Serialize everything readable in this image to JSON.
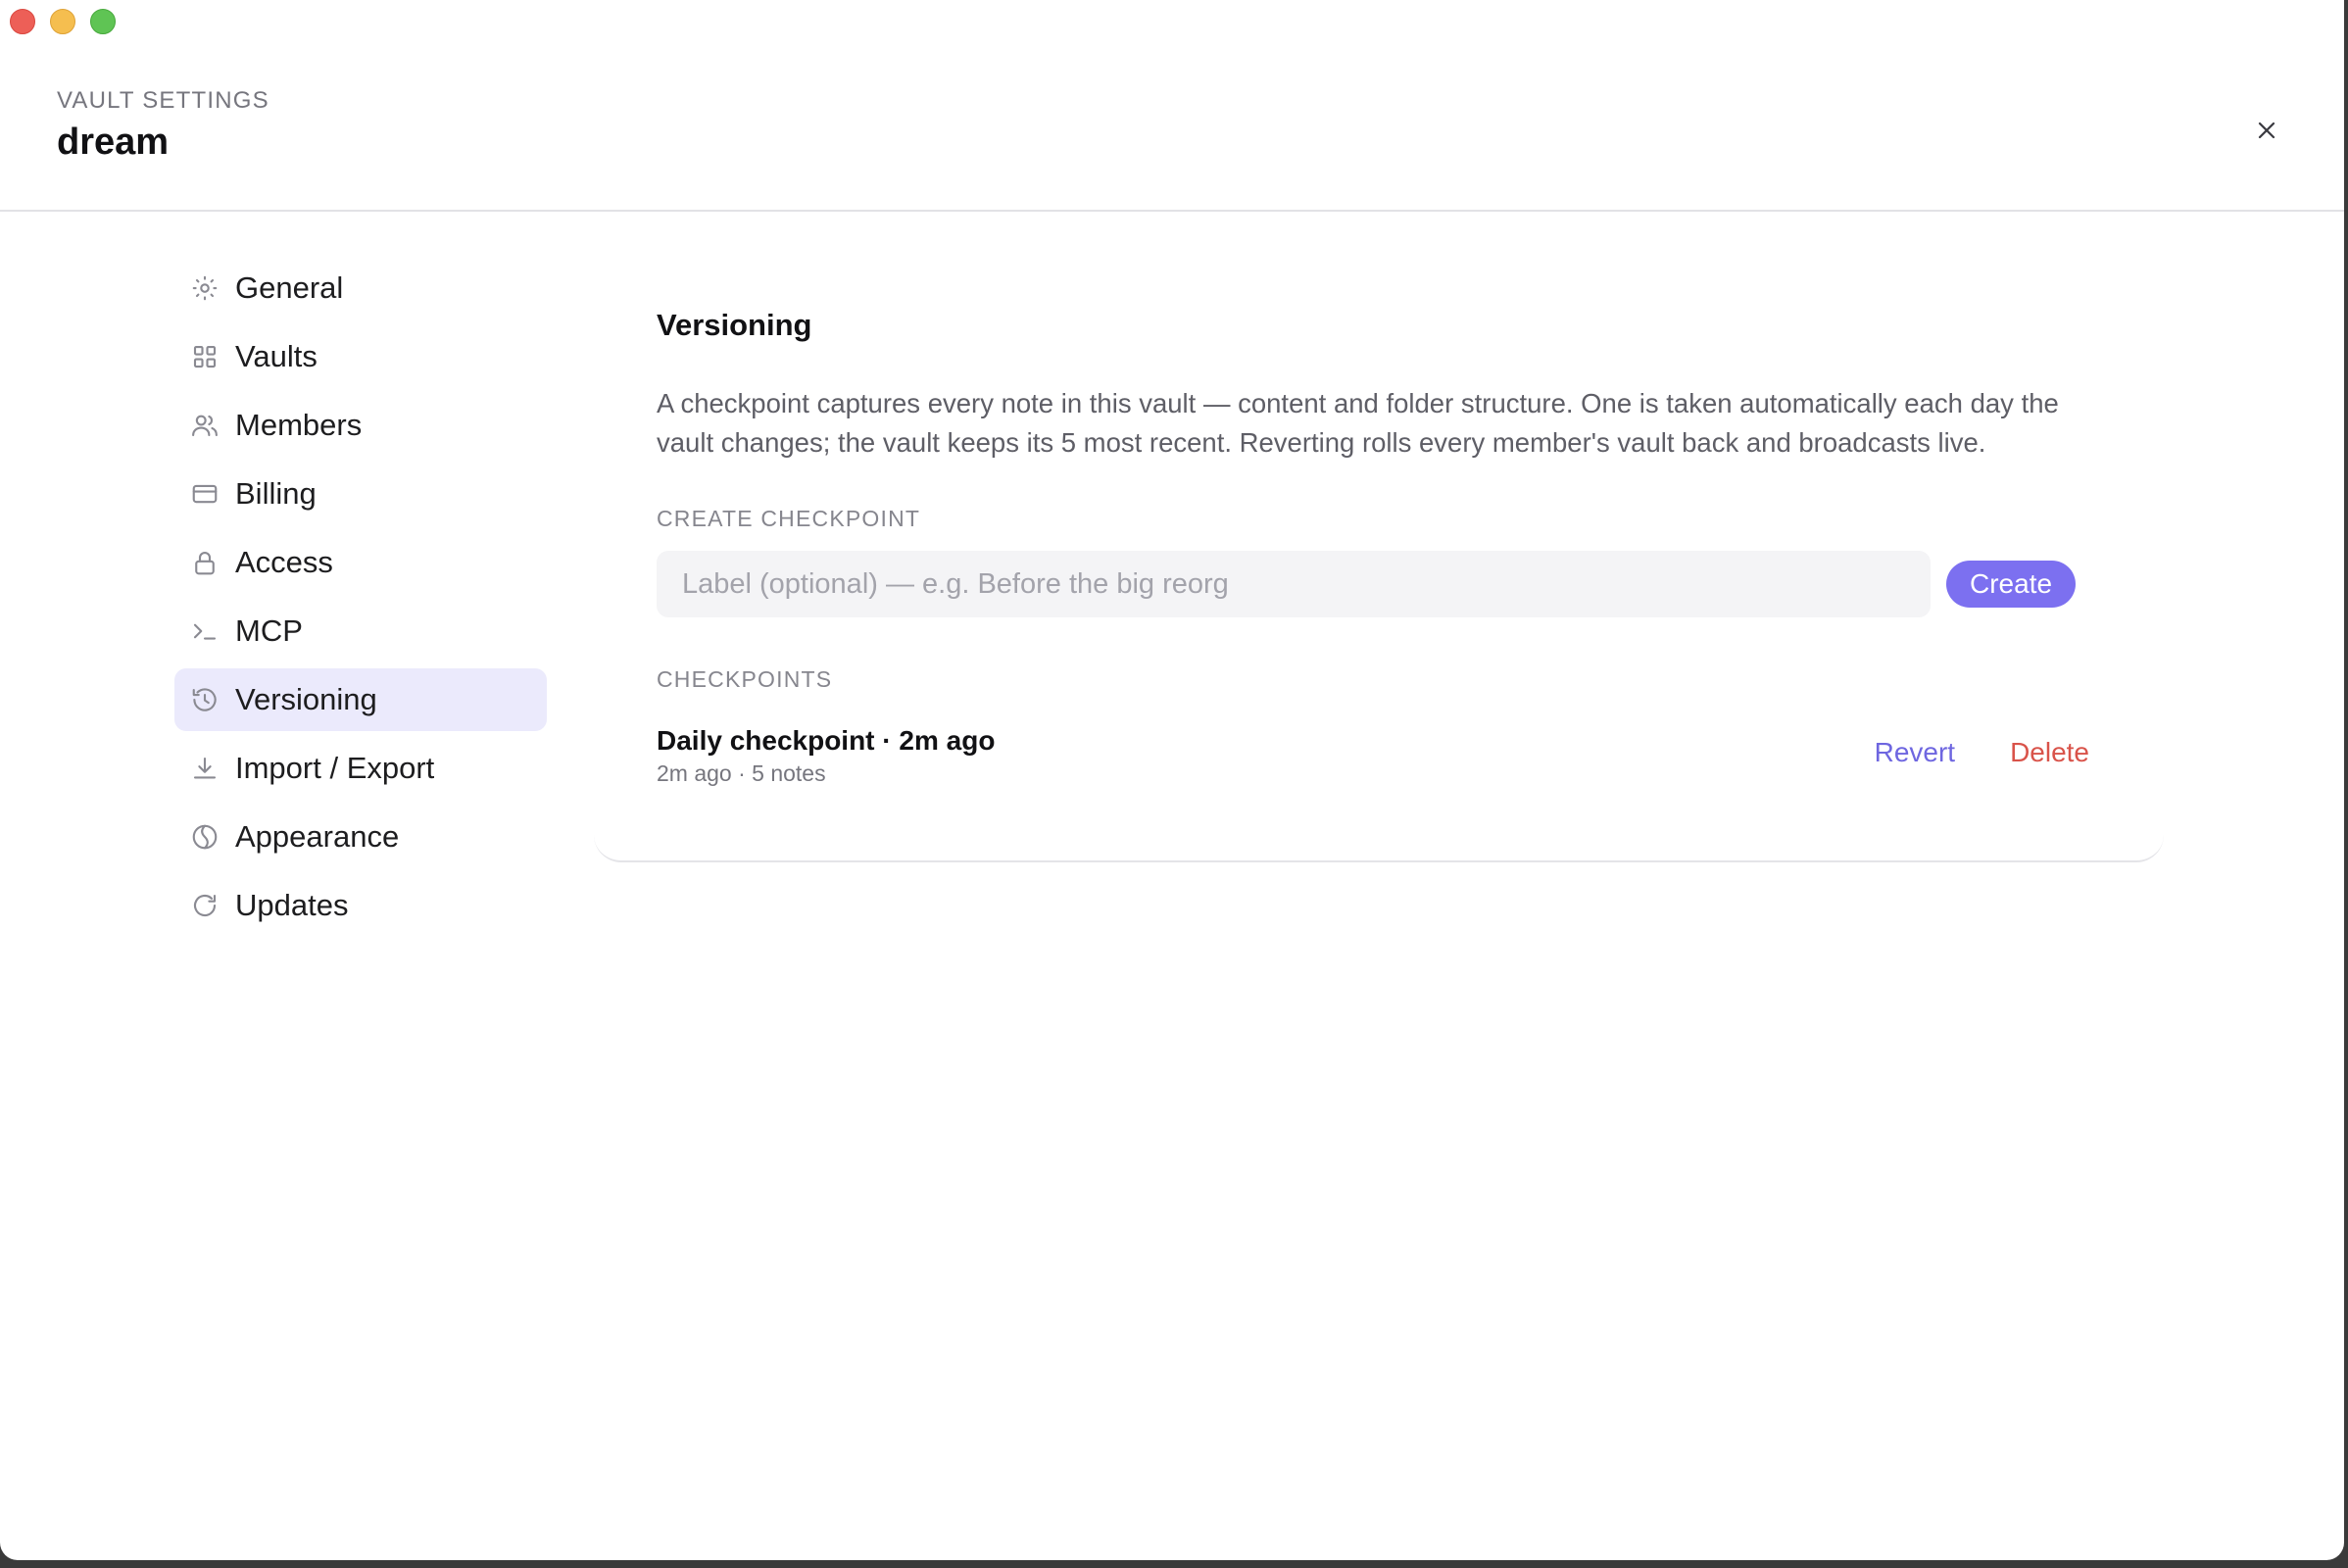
{
  "window": {
    "controls": [
      "close",
      "minimize",
      "maximize"
    ]
  },
  "header": {
    "eyebrow": "VAULT SETTINGS",
    "vault_name": "dream",
    "close_icon": "close-icon"
  },
  "sidebar": {
    "items": [
      {
        "label": "General",
        "icon": "sun-icon",
        "active": false
      },
      {
        "label": "Vaults",
        "icon": "grid-icon",
        "active": false
      },
      {
        "label": "Members",
        "icon": "users-icon",
        "active": false
      },
      {
        "label": "Billing",
        "icon": "card-icon",
        "active": false
      },
      {
        "label": "Access",
        "icon": "lock-icon",
        "active": false
      },
      {
        "label": "MCP",
        "icon": "terminal-icon",
        "active": false
      },
      {
        "label": "Versioning",
        "icon": "history-icon",
        "active": true
      },
      {
        "label": "Import / Export",
        "icon": "download-icon",
        "active": false
      },
      {
        "label": "Appearance",
        "icon": "appearance-icon",
        "active": false
      },
      {
        "label": "Updates",
        "icon": "refresh-icon",
        "active": false
      }
    ]
  },
  "main": {
    "title": "Versioning",
    "description": "A checkpoint captures every note in this vault — content and folder structure. One is taken automatically each day the vault changes; the vault keeps its 5 most recent. Reverting rolls every member's vault back and broadcasts live.",
    "create_section_label": "CREATE CHECKPOINT",
    "label_input": {
      "placeholder": "Label (optional) — e.g. Before the big reorg",
      "value": ""
    },
    "create_button": "Create",
    "checkpoints_section_label": "CHECKPOINTS",
    "checkpoints": [
      {
        "title": "Daily checkpoint · 2m ago",
        "meta": "2m ago · 5 notes",
        "revert_label": "Revert",
        "delete_label": "Delete"
      }
    ]
  },
  "colors": {
    "accent": "#7c70f0",
    "active_nav_bg": "#ebeafc",
    "revert": "#6e66e0",
    "delete": "#d9534a"
  }
}
